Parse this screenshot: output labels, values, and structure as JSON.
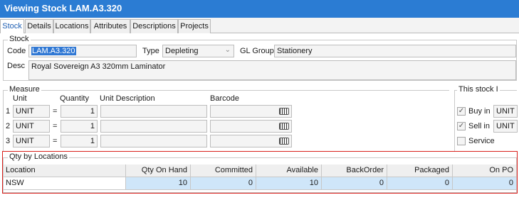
{
  "window": {
    "title": "Viewing Stock LAM.A3.320"
  },
  "tabs": [
    "Stock",
    "Details",
    "Locations",
    "Attributes",
    "Descriptions",
    "Projects"
  ],
  "stock": {
    "group_label": "Stock",
    "code_label": "Code",
    "code_value": "LAM.A3.320",
    "type_label": "Type",
    "type_value": "Depleting",
    "gl_label": "GL Group",
    "gl_value": "Stationery",
    "desc_label": "Desc",
    "desc_value": "Royal Sovereign A3 320mm Laminator"
  },
  "measure": {
    "group_label": "Measure",
    "headers": {
      "unit": "Unit",
      "quantity": "Quantity",
      "unit_description": "Unit Description",
      "barcode": "Barcode"
    },
    "rows": [
      {
        "index": "1",
        "unit": "UNIT",
        "eq": "=",
        "quantity": "1",
        "unit_description": "",
        "barcode": ""
      },
      {
        "index": "2",
        "unit": "UNIT",
        "eq": "=",
        "quantity": "1",
        "unit_description": "",
        "barcode": ""
      },
      {
        "index": "3",
        "unit": "UNIT",
        "eq": "=",
        "quantity": "1",
        "unit_description": "",
        "barcode": ""
      }
    ]
  },
  "this_stock": {
    "group_label": "This stock I",
    "options": [
      {
        "label": "Buy in",
        "checked": true,
        "unit": "UNIT"
      },
      {
        "label": "Sell in",
        "checked": true,
        "unit": "UNIT"
      },
      {
        "label": "Service",
        "checked": false,
        "unit": ""
      }
    ]
  },
  "qty_by_locations": {
    "group_label": "Qty by Locations",
    "columns": [
      "Location",
      "Qty On Hand",
      "Committed",
      "Available",
      "BackOrder",
      "Packaged",
      "On PO"
    ],
    "rows": [
      [
        "NSW",
        "10",
        "0",
        "10",
        "0",
        "0",
        "0"
      ]
    ]
  },
  "colors": {
    "titlebar": "#2b7cd3",
    "selection": "#3078d4",
    "row_highlight": "#cfe6f9",
    "callout": "#d9201c"
  }
}
